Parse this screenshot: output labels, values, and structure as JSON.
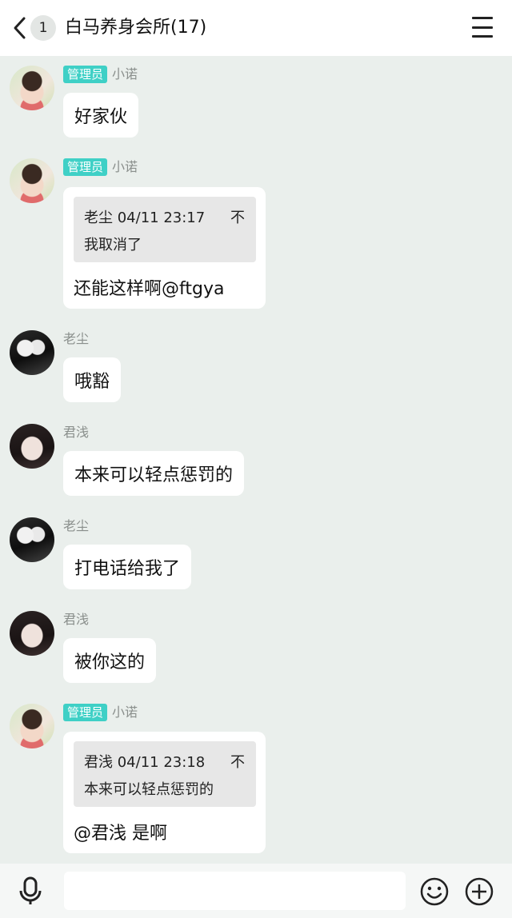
{
  "header": {
    "unread_count": "1",
    "title": "白马养身会所(17)"
  },
  "messages": [
    {
      "sender": "小诺",
      "admin_tag": "管理员",
      "text": "好家伙"
    },
    {
      "sender": "小诺",
      "admin_tag": "管理员",
      "quote": {
        "author_time": "老尘 04/11 23:17",
        "pin": "不",
        "text": "我取消了"
      },
      "text": "还能这样啊@ftgya"
    },
    {
      "sender": "老尘",
      "text": "哦豁"
    },
    {
      "sender": "君浅",
      "text": "本来可以轻点惩罚的"
    },
    {
      "sender": "老尘",
      "text": "打电话给我了"
    },
    {
      "sender": "君浅",
      "text": "被你这的"
    },
    {
      "sender": "小诺",
      "admin_tag": "管理员",
      "quote": {
        "author_time": "君浅 04/11 23:18",
        "pin": "不",
        "text": "本来可以轻点惩罚的"
      },
      "text": "@君浅 是啊"
    }
  ],
  "input_bar": {
    "placeholder": "",
    "icons": [
      "microphone-icon",
      "emoji-icon",
      "plus-icon"
    ]
  },
  "colors": {
    "chat_background": "#eaefec",
    "admin_tag": "#3fd0c6",
    "bubble": "#ffffff",
    "quote_box": "#e7e7e7"
  }
}
